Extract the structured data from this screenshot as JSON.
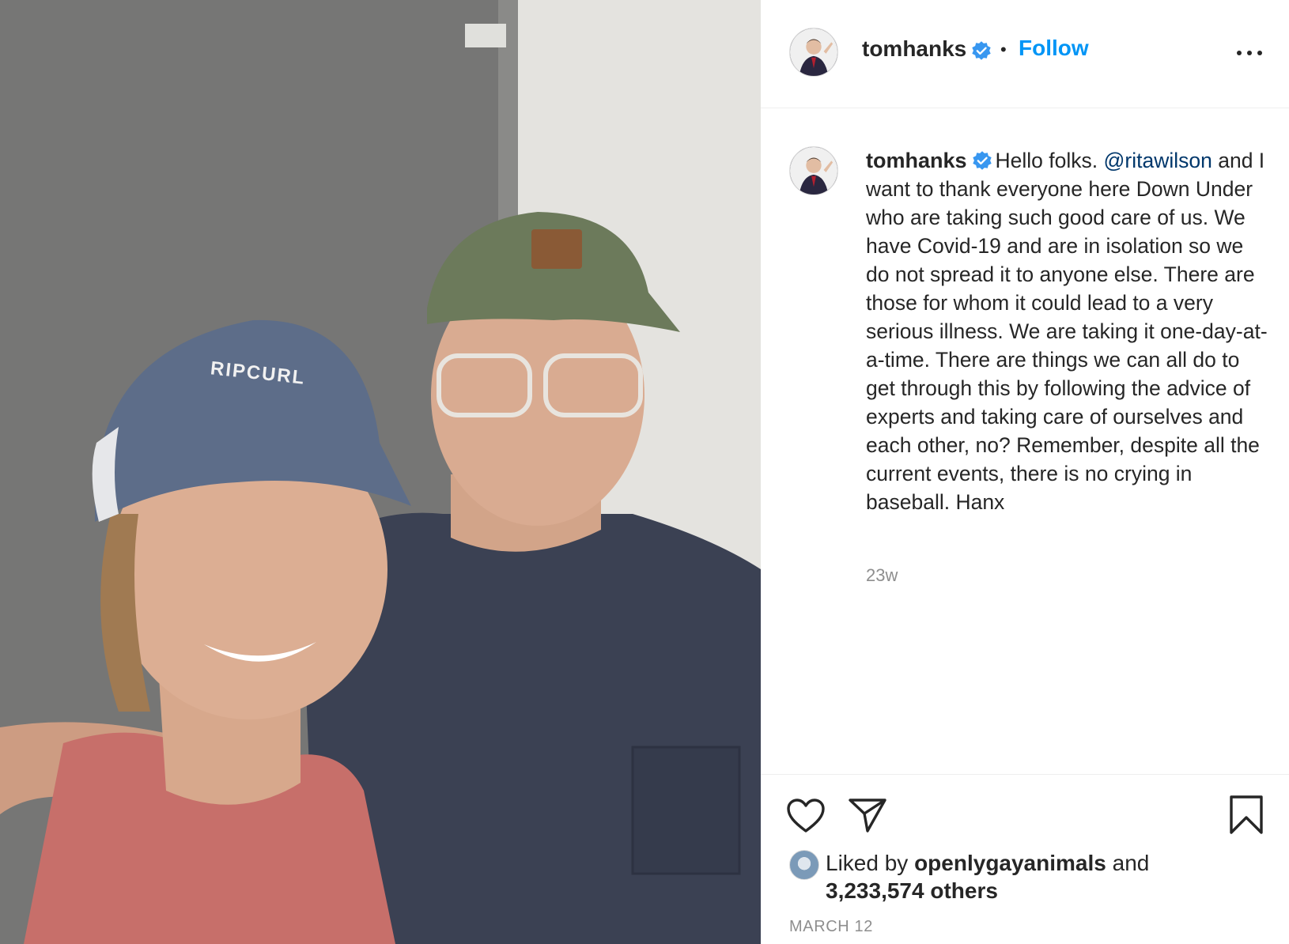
{
  "photo": {
    "alt_hat_text": "RIPCURL"
  },
  "header": {
    "username": "tomhanks",
    "separator": "•",
    "follow_label": "Follow"
  },
  "caption": {
    "username": "tomhanks",
    "text_before_mention": "Hello folks. ",
    "mention": "@ritawilson",
    "text_after_mention": " and I want to thank everyone here Down Under who are taking such good care of us. We have Covid-19 and are in isolation so we do not spread it to anyone else. There are those for whom it could lead to a very serious illness. We are taking it one-day-at-a-time. There are things we can all do to get through this by following the advice of experts and taking care of ourselves and each other, no? Remember, despite all the current events, there is no crying in baseball. Hanx",
    "time_ago": "23w"
  },
  "likes": {
    "prefix": "Liked by ",
    "liker": "openlygayanimals",
    "suffix": " and",
    "count_text": "3,233,574 others"
  },
  "post_date": "MARCH 12",
  "icons": {
    "like": "heart-icon",
    "share": "paper-plane-icon",
    "save": "bookmark-icon",
    "more": "ellipsis-icon",
    "verified": "verified-badge-icon"
  },
  "colors": {
    "follow_blue": "#0095f6",
    "verified_blue": "#3897f0",
    "mention": "#00376b",
    "muted": "#8e8e8e",
    "text": "#262626"
  }
}
